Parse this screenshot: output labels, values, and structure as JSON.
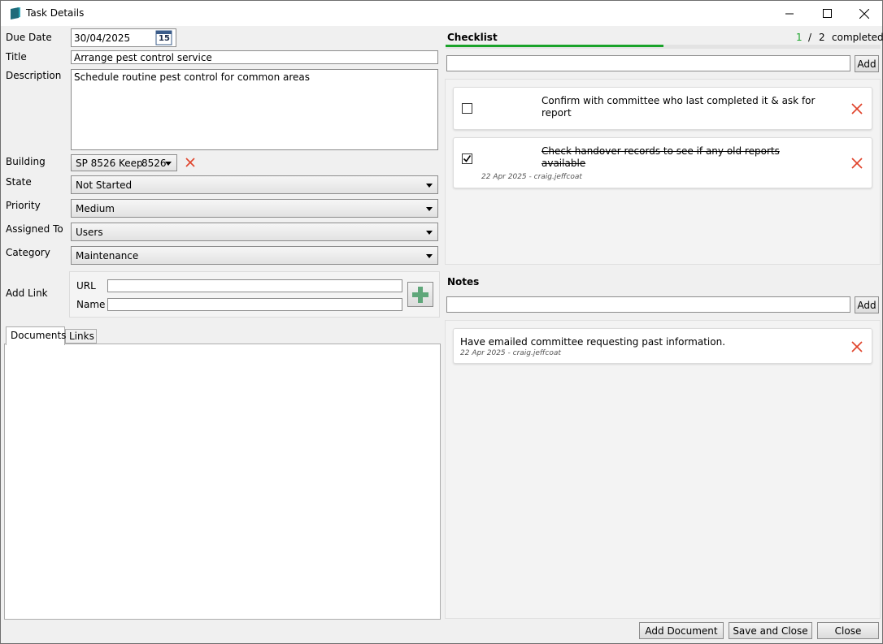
{
  "window": {
    "title": "Task Details"
  },
  "form": {
    "due_date_label": "Due Date",
    "due_date_value": "30/04/2025",
    "calendar_day": "15",
    "title_label": "Title",
    "title_value": "Arrange pest control service",
    "description_label": "Description",
    "description_value": "Schedule routine pest control for common areas",
    "building_label": "Building",
    "building_value": "SP 8526 Keep",
    "building_code": "8526",
    "state_label": "State",
    "state_value": "Not Started",
    "priority_label": "Priority",
    "priority_value": "Medium",
    "assigned_label": "Assigned To",
    "assigned_value": "Users",
    "category_label": "Category",
    "category_value": "Maintenance"
  },
  "add_link": {
    "label": "Add Link",
    "url_label": "URL",
    "url_value": "",
    "name_label": "Name",
    "name_value": ""
  },
  "tabs": [
    {
      "label": "Documents",
      "active": true
    },
    {
      "label": "Links",
      "active": false
    }
  ],
  "checklist": {
    "heading": "Checklist",
    "completed_count": "1",
    "separator": "/",
    "total_count": "2",
    "completed_word": "completed",
    "progress": 0.5,
    "progress_color": "#1aa32a",
    "add_label": "Add",
    "input_value": "",
    "items": [
      {
        "text_line1": "Confirm with committee who last completed it & ask for",
        "text_line2": "report",
        "checked": false,
        "meta": ""
      },
      {
        "text_line1": "Check handover records to see if any old reports",
        "text_line2": "available",
        "checked": true,
        "meta": "22 Apr 2025 - craig.jeffcoat"
      }
    ]
  },
  "notes": {
    "heading": "Notes",
    "add_label": "Add",
    "input_value": "",
    "items": [
      {
        "text": "Have emailed committee requesting past information.",
        "meta": "22 Apr 2025 - craig.jeffcoat"
      }
    ]
  },
  "footer": {
    "add_document": "Add Document",
    "save_close": "Save and Close",
    "close": "Close"
  },
  "colors": {
    "delete": "#e0442c",
    "accent": "#1aa32a",
    "add_link_plus": "#5fa77a"
  }
}
